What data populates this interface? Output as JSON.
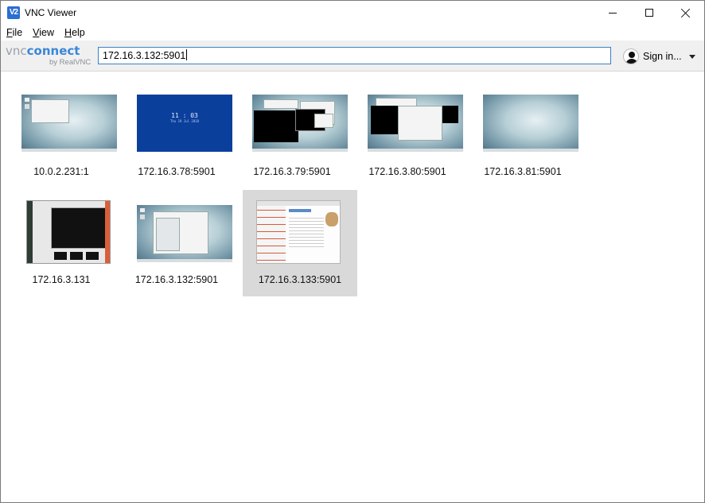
{
  "window": {
    "title": "VNC Viewer",
    "app_icon_glyph": "V2",
    "controls": {
      "minimize": "minimize-icon",
      "maximize": "maximize-icon",
      "close": "close-icon"
    }
  },
  "menu": [
    {
      "key": "F",
      "rest": "ile"
    },
    {
      "key": "V",
      "rest": "iew"
    },
    {
      "key": "H",
      "rest": "elp"
    }
  ],
  "toolbar": {
    "logo_vnc": "vnc",
    "logo_connect": "connect",
    "logo_by": "by RealVNC",
    "address_value": "172.16.3.132:5901",
    "signin_label": "Sign in...",
    "signin_icon": "user-icon",
    "dropdown_icon": "chevron-down-icon"
  },
  "connections": [
    {
      "label": "10.0.2.231:1",
      "thumb": "desktop-window"
    },
    {
      "label": "172.16.3.78:5901",
      "thumb": "lock-screen",
      "clock_time": "11 : 03",
      "clock_date": "Thu 19 Jul 2018"
    },
    {
      "label": "172.16.3.79:5901",
      "thumb": "terminals"
    },
    {
      "label": "172.16.3.80:5901",
      "thumb": "terminal-files"
    },
    {
      "label": "172.16.3.81:5901",
      "thumb": "empty-desktop"
    },
    {
      "label": "172.16.3.131",
      "thumb": "dark-desktop"
    },
    {
      "label": "172.16.3.132:5901",
      "thumb": "file-dialog"
    },
    {
      "label": "172.16.3.133:5901",
      "thumb": "browser-page",
      "selected": true
    }
  ],
  "colors": {
    "accent": "#3c7fc6",
    "selected_tile": "#d9d9d9",
    "toolbar_bg": "#f0f0f0",
    "logo_connect": "#3a86d9"
  }
}
